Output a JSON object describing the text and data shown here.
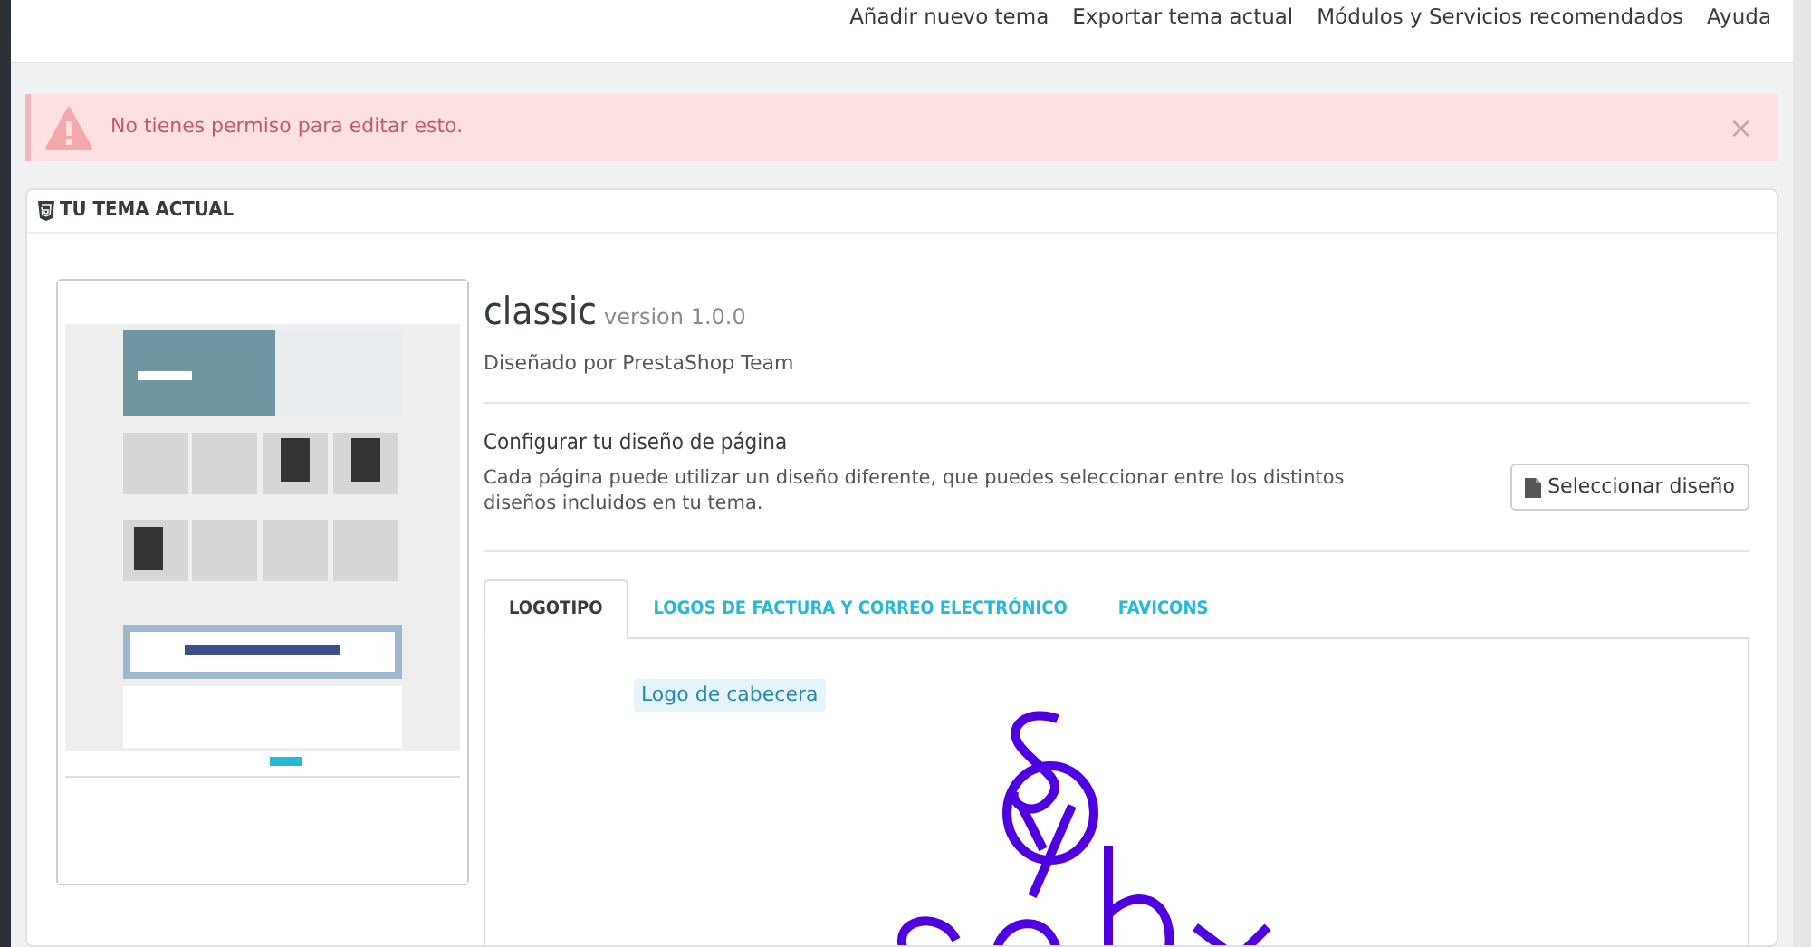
{
  "header": {
    "links": [
      "Añadir nuevo tema",
      "Exportar tema actual",
      "Módulos y Servicios recomendados",
      "Ayuda"
    ]
  },
  "alert": {
    "message": "No tienes permiso para editar esto.",
    "close": "×"
  },
  "panel": {
    "title": "TU TEMA ACTUAL",
    "theme": {
      "name": "classic",
      "version": "version 1.0.0",
      "author": "Diseñado por PrestaShop Team"
    },
    "layout": {
      "title": "Configurar tu diseño de página",
      "description": "Cada página puede utilizar un diseño diferente, que puedes seleccionar entre los distintos diseños incluidos en tu tema.",
      "button": "Seleccionar diseño"
    },
    "tabs": [
      {
        "label": "LOGOTIPO",
        "selected": true
      },
      {
        "label": "LOGOS DE FACTURA Y CORREO ELECTRÓNICO",
        "selected": false
      },
      {
        "label": "FAVICONS",
        "selected": false
      }
    ],
    "logo_section": {
      "label": "Logo de cabecera"
    }
  }
}
